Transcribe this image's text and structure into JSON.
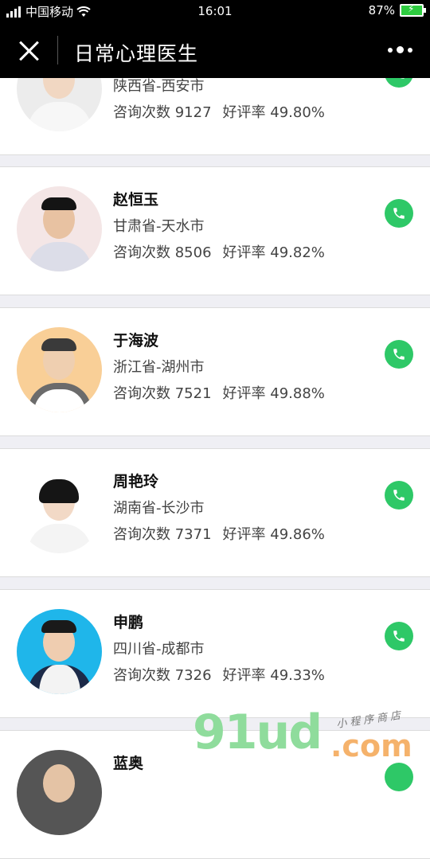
{
  "status_bar": {
    "carrier": "中国移动",
    "time": "16:01",
    "battery": "87%"
  },
  "nav": {
    "title": "日常心理医生"
  },
  "doctors": [
    {
      "name": "",
      "location": "陕西省-西安市",
      "consult_label": "咨询次数",
      "consult_count": "9127",
      "rating_label": "好评率",
      "rating": "49.80%"
    },
    {
      "name": "赵恒玉",
      "location": "甘肃省-天水市",
      "consult_label": "咨询次数",
      "consult_count": "8506",
      "rating_label": "好评率",
      "rating": "49.82%"
    },
    {
      "name": "于海波",
      "location": "浙江省-湖州市",
      "consult_label": "咨询次数",
      "consult_count": "7521",
      "rating_label": "好评率",
      "rating": "49.88%"
    },
    {
      "name": "周艳玲",
      "location": "湖南省-长沙市",
      "consult_label": "咨询次数",
      "consult_count": "7371",
      "rating_label": "好评率",
      "rating": "49.86%"
    },
    {
      "name": "申鹏",
      "location": "四川省-成都市",
      "consult_label": "咨询次数",
      "consult_count": "7326",
      "rating_label": "好评率",
      "rating": "49.33%"
    },
    {
      "name": "蓝奥",
      "location": "",
      "consult_label": "",
      "consult_count": "",
      "rating_label": "",
      "rating": ""
    }
  ],
  "watermark": {
    "main": "91ud",
    "suffix": ".com",
    "subtitle": "小程序商店"
  },
  "colors": {
    "call_button": "#2ec867",
    "nav_background": "#000000"
  },
  "icons": [
    "signal-icon",
    "wifi-icon",
    "battery-icon",
    "close-icon",
    "more-icon",
    "phone-icon"
  ]
}
